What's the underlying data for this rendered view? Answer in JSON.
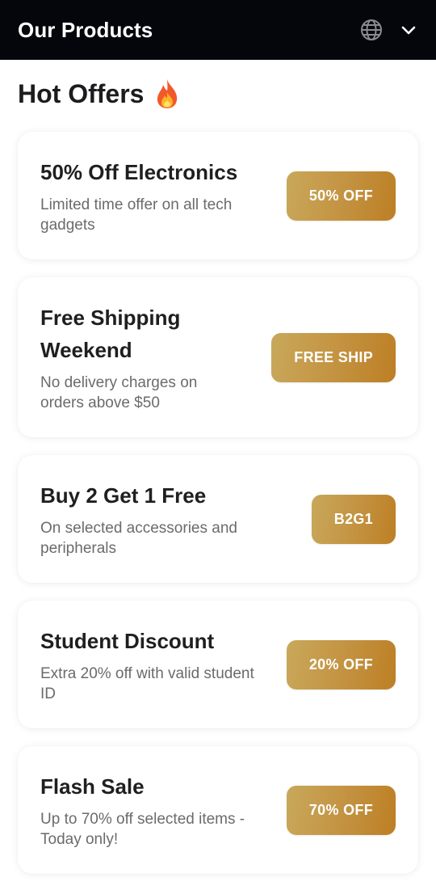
{
  "header": {
    "title": "Our Products",
    "language_icon": "globe-icon",
    "menu_icon": "chevron-down-icon"
  },
  "section": {
    "title": "Hot Offers",
    "title_icon": "fire-icon"
  },
  "offers": [
    {
      "title": "50% Off Electronics",
      "description": "Limited time offer on all tech gadgets",
      "badge": "50% OFF"
    },
    {
      "title": "Free Shipping Weekend",
      "description": "No delivery charges on orders above $50",
      "badge": "FREE SHIP"
    },
    {
      "title": "Buy 2 Get 1 Free",
      "description": "On selected accessories and peripherals",
      "badge": "B2G1"
    },
    {
      "title": "Student Discount",
      "description": "Extra 20% off with valid student ID",
      "badge": "20% OFF"
    },
    {
      "title": "Flash Sale",
      "description": "Up to 70% off selected items - Today only!",
      "badge": "70% OFF"
    }
  ],
  "colors": {
    "header_bg": "#05060c",
    "badge_gradient_start": "#c9a85b",
    "badge_gradient_end": "#bd7f24",
    "title_text": "#1f1f1f",
    "desc_text": "#6b6b6b"
  }
}
